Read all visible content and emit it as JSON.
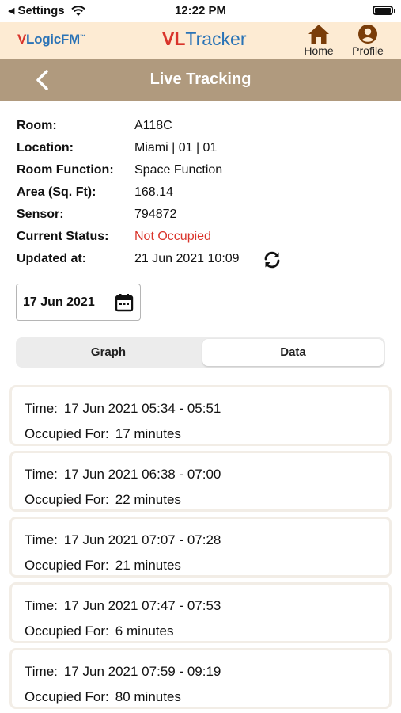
{
  "status_bar": {
    "back_app": "Settings",
    "time": "12:22 PM"
  },
  "header": {
    "left_logo_v": "V",
    "left_logo_rest": "LogicFM",
    "left_logo_tm": "™",
    "center_logo_vl": "VL",
    "center_logo_rest": "Tracker",
    "home_label": "Home",
    "profile_label": "Profile"
  },
  "nav": {
    "title": "Live Tracking"
  },
  "info": {
    "room_label": "Room:",
    "room_value": "A118C",
    "location_label": "Location:",
    "location_value": "Miami | 01 | 01",
    "function_label": "Room Function:",
    "function_value": "Space Function",
    "area_label": "Area (Sq. Ft):",
    "area_value": "168.14",
    "sensor_label": "Sensor:",
    "sensor_value": "794872",
    "status_label": "Current Status:",
    "status_value": "Not Occupied",
    "updated_label": "Updated at:",
    "updated_value": "21 Jun 2021 10:09"
  },
  "date_picker": {
    "value": "17 Jun 2021"
  },
  "tabs": {
    "graph": "Graph",
    "data": "Data",
    "selected": "Data"
  },
  "records": {
    "time_label": "Time:",
    "occupied_label": "Occupied For:",
    "items": [
      {
        "time": "17 Jun 2021 05:34 - 05:51",
        "duration": "17 minutes"
      },
      {
        "time": "17 Jun 2021 06:38 - 07:00",
        "duration": "22 minutes"
      },
      {
        "time": "17 Jun 2021 07:07 - 07:28",
        "duration": "21 minutes"
      },
      {
        "time": "17 Jun 2021 07:47 - 07:53",
        "duration": "6 minutes"
      },
      {
        "time": "17 Jun 2021 07:59 - 09:19",
        "duration": "80 minutes"
      }
    ]
  },
  "colors": {
    "header_bg": "#fdebd3",
    "nav_bg": "#b09a7e",
    "brand_red": "#d9342b",
    "brand_blue": "#2a73b6",
    "status_red": "#d9342b"
  },
  "icons": {
    "back": "chevron-left-icon",
    "home": "home-icon",
    "profile": "user-circle-icon",
    "refresh": "refresh-icon",
    "calendar": "calendar-icon",
    "wifi": "wifi-icon",
    "battery": "battery-icon"
  }
}
